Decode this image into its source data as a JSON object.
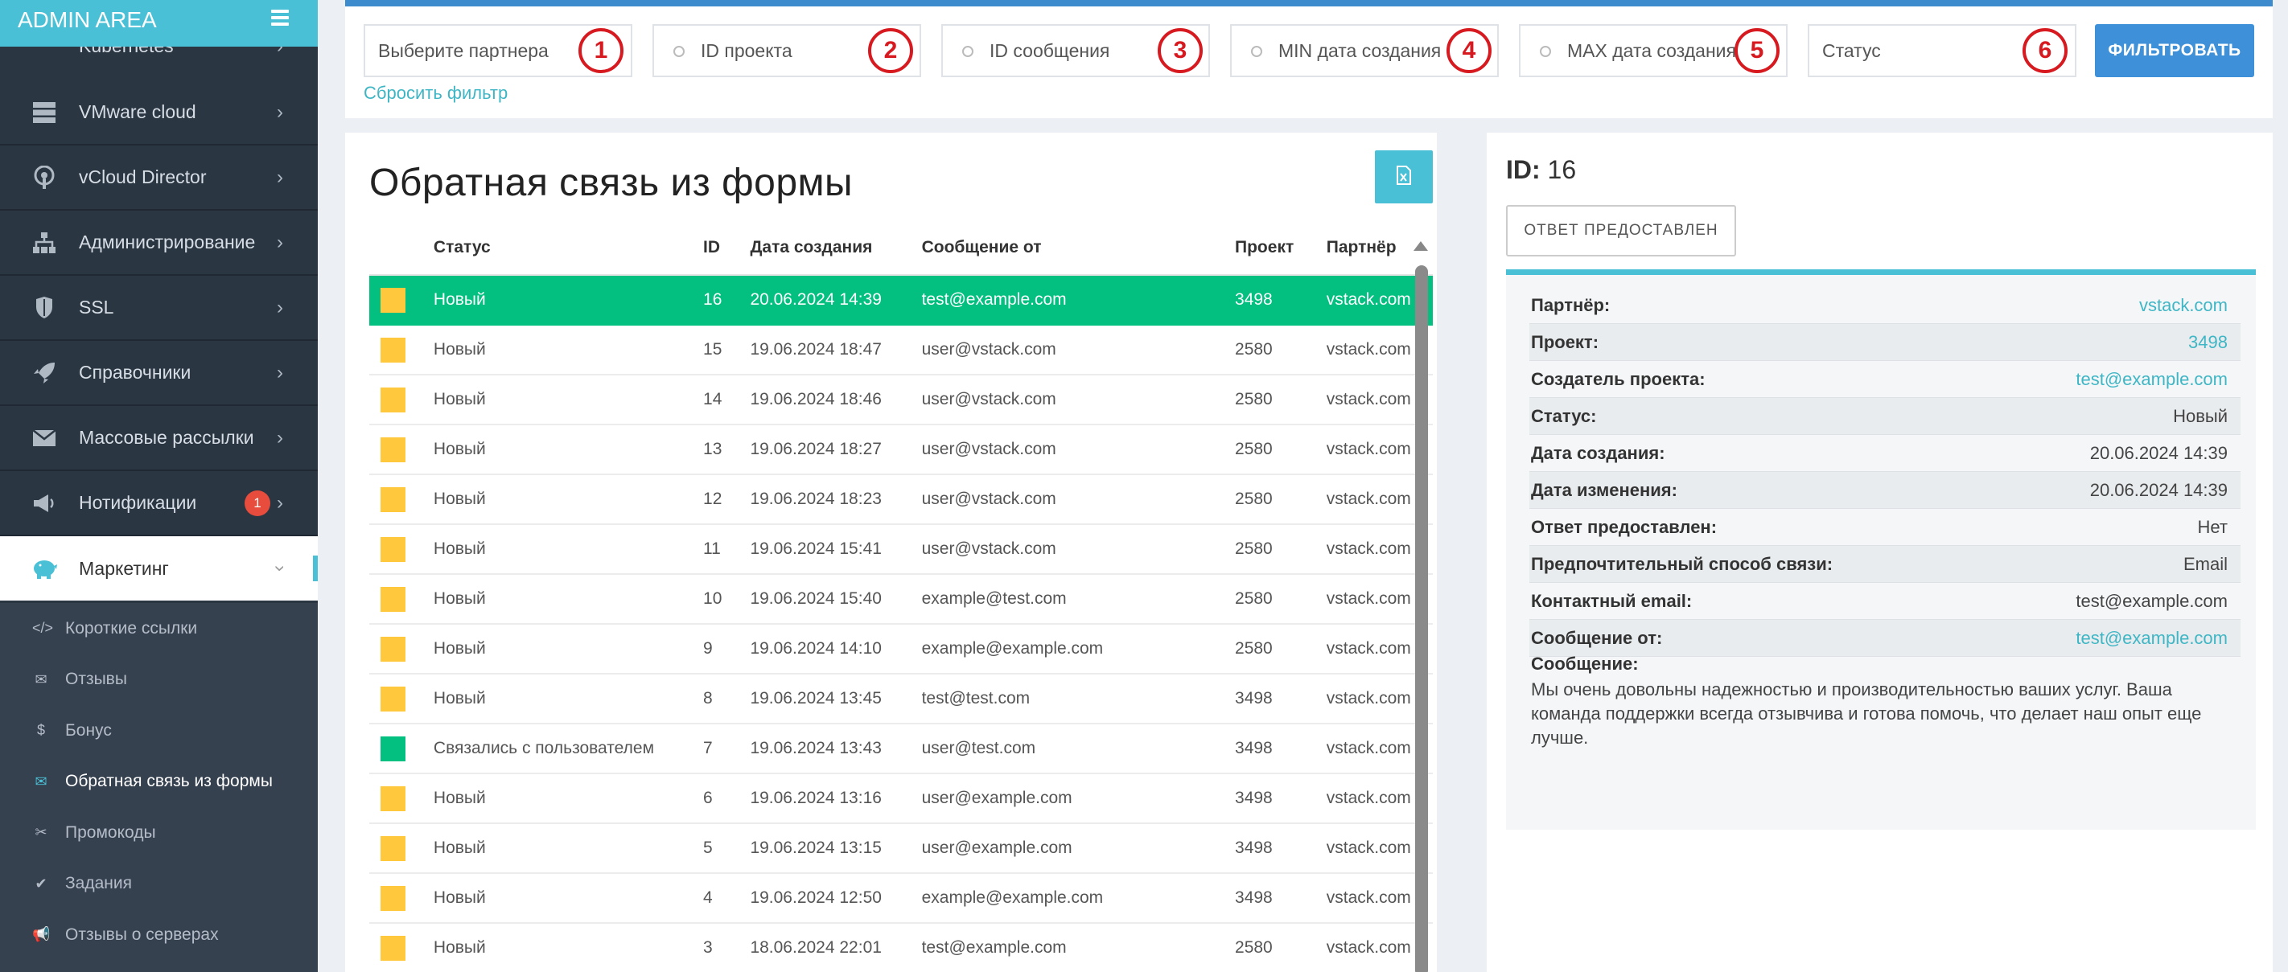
{
  "brand": {
    "title": "ADMIN AREA"
  },
  "sidebar": {
    "items": [
      {
        "label": "Kubernetes",
        "icon": "kubernetes-icon"
      },
      {
        "label": "VMware cloud",
        "icon": "server-icon"
      },
      {
        "label": "vCloud Director",
        "icon": "podcast-icon"
      },
      {
        "label": "Администрирование",
        "icon": "sitemap-icon"
      },
      {
        "label": "SSL",
        "icon": "shield-icon"
      },
      {
        "label": "Справочники",
        "icon": "rocket-icon"
      },
      {
        "label": "Массовые рассылки",
        "icon": "envelope-icon"
      },
      {
        "label": "Нотификации",
        "icon": "megaphone-icon",
        "badge": "1"
      },
      {
        "label": "Маркетинг",
        "icon": "piggy-bank-icon"
      }
    ],
    "submenu": [
      {
        "label": "Короткие ссылки",
        "icon": "</>"
      },
      {
        "label": "Отзывы",
        "icon": "✉"
      },
      {
        "label": "Бонус",
        "icon": "$"
      },
      {
        "label": "Обратная связь из формы",
        "icon": "✉"
      },
      {
        "label": "Промокоды",
        "icon": "✂"
      },
      {
        "label": "Задания",
        "icon": "✔"
      },
      {
        "label": "Отзывы о серверах",
        "icon": "📢"
      }
    ]
  },
  "filters": {
    "partner_placeholder": "Выберите партнера",
    "project_id_placeholder": "ID проекта",
    "message_id_placeholder": "ID сообщения",
    "min_date_placeholder": "MIN дата создания",
    "max_date_placeholder": "MAX дата создания",
    "status_placeholder": "Статус",
    "badges": [
      "1",
      "2",
      "3",
      "4",
      "5",
      "6"
    ],
    "filter_button": "ФИЛЬТРОВАТЬ",
    "reset_link": "Сбросить фильтр"
  },
  "main": {
    "title": "Обратная связь из формы",
    "columns": [
      "Статус",
      "ID",
      "Дата создания",
      "Сообщение от",
      "Проект",
      "Партнёр"
    ],
    "rows": [
      {
        "color": "yellow",
        "status": "Новый",
        "id": "16",
        "date": "20.06.2024 14:39",
        "from": "test@example.com",
        "project": "3498",
        "partner": "vstack.com",
        "selected": true
      },
      {
        "color": "yellow",
        "status": "Новый",
        "id": "15",
        "date": "19.06.2024 18:47",
        "from": "user@vstack.com",
        "project": "2580",
        "partner": "vstack.com"
      },
      {
        "color": "yellow",
        "status": "Новый",
        "id": "14",
        "date": "19.06.2024 18:46",
        "from": "user@vstack.com",
        "project": "2580",
        "partner": "vstack.com"
      },
      {
        "color": "yellow",
        "status": "Новый",
        "id": "13",
        "date": "19.06.2024 18:27",
        "from": "user@vstack.com",
        "project": "2580",
        "partner": "vstack.com"
      },
      {
        "color": "yellow",
        "status": "Новый",
        "id": "12",
        "date": "19.06.2024 18:23",
        "from": "user@vstack.com",
        "project": "2580",
        "partner": "vstack.com"
      },
      {
        "color": "yellow",
        "status": "Новый",
        "id": "11",
        "date": "19.06.2024 15:41",
        "from": "user@vstack.com",
        "project": "2580",
        "partner": "vstack.com"
      },
      {
        "color": "yellow",
        "status": "Новый",
        "id": "10",
        "date": "19.06.2024 15:40",
        "from": "example@test.com",
        "project": "2580",
        "partner": "vstack.com"
      },
      {
        "color": "yellow",
        "status": "Новый",
        "id": "9",
        "date": "19.06.2024 14:10",
        "from": "example@example.com",
        "project": "2580",
        "partner": "vstack.com"
      },
      {
        "color": "yellow",
        "status": "Новый",
        "id": "8",
        "date": "19.06.2024 13:45",
        "from": "test@test.com",
        "project": "3498",
        "partner": "vstack.com"
      },
      {
        "color": "green",
        "status": "Связались с пользователем",
        "id": "7",
        "date": "19.06.2024 13:43",
        "from": "user@test.com",
        "project": "3498",
        "partner": "vstack.com"
      },
      {
        "color": "yellow",
        "status": "Новый",
        "id": "6",
        "date": "19.06.2024 13:16",
        "from": "user@example.com",
        "project": "3498",
        "partner": "vstack.com"
      },
      {
        "color": "yellow",
        "status": "Новый",
        "id": "5",
        "date": "19.06.2024 13:15",
        "from": "user@example.com",
        "project": "3498",
        "partner": "vstack.com"
      },
      {
        "color": "yellow",
        "status": "Новый",
        "id": "4",
        "date": "19.06.2024 12:50",
        "from": "example@example.com",
        "project": "3498",
        "partner": "vstack.com"
      },
      {
        "color": "yellow",
        "status": "Новый",
        "id": "3",
        "date": "18.06.2024 22:01",
        "from": "test@example.com",
        "project": "2580",
        "partner": "vstack.com"
      }
    ]
  },
  "detail": {
    "id_label": "ID:",
    "id_value": "16",
    "answer_button": "ОТВЕТ ПРЕДОСТАВЛЕН",
    "fields": [
      {
        "label": "Партнёр:",
        "value": "vstack.com",
        "link": true
      },
      {
        "label": "Проект:",
        "value": "3498",
        "link": true
      },
      {
        "label": "Создатель проекта:",
        "value": "test@example.com",
        "link": true
      },
      {
        "label": "Статус:",
        "value": "Новый",
        "link": false
      },
      {
        "label": "Дата создания:",
        "value": "20.06.2024 14:39",
        "link": false
      },
      {
        "label": "Дата изменения:",
        "value": "20.06.2024 14:39",
        "link": false
      },
      {
        "label": "Ответ предоставлен:",
        "value": "Нет",
        "link": false
      },
      {
        "label": "Предпочтительный способ связи:",
        "value": "Email",
        "link": false
      },
      {
        "label": "Контактный email:",
        "value": "test@example.com",
        "link": false
      },
      {
        "label": "Сообщение от:",
        "value": "test@example.com",
        "link": true
      }
    ],
    "message_label": "Сообщение:",
    "message_text": "Мы очень довольны надежностью и производительностью ваших услуг. Ваша команда поддержки всегда отзывчива и готова помочь, что делает наш опыт еще лучше."
  },
  "colors": {
    "accent": "#4ac0d6",
    "primary": "#3e90d8",
    "success": "#03c080",
    "warning": "#ffc83d",
    "sidebar": "#2b3643",
    "badge": "#e74c3c"
  }
}
